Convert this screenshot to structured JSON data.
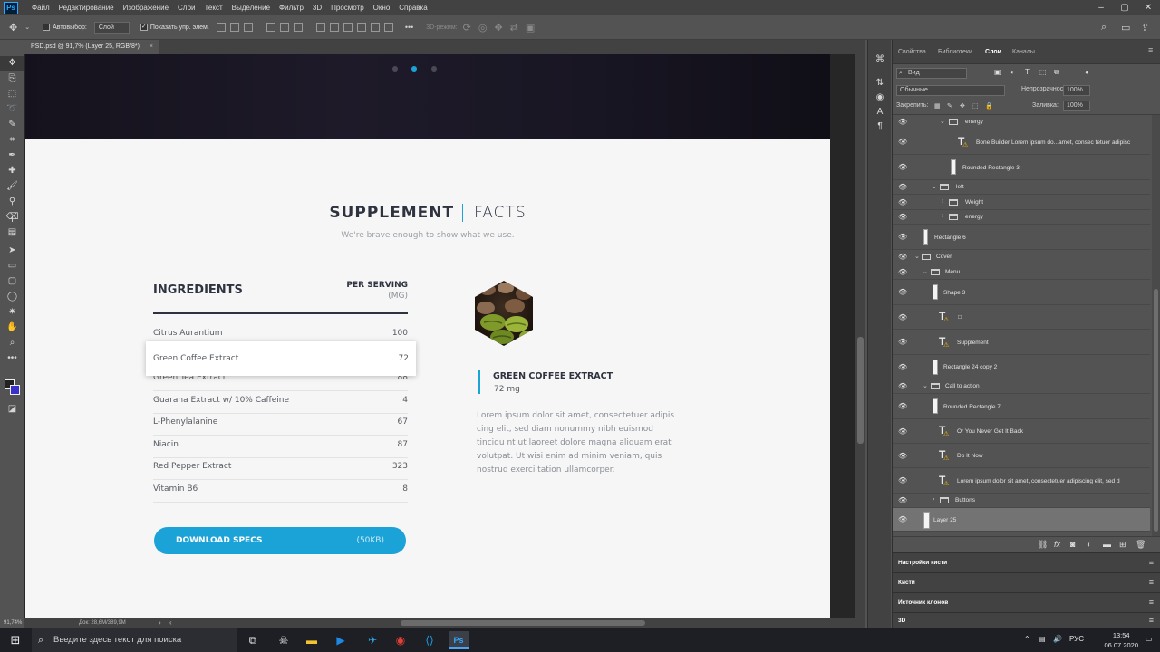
{
  "app": {
    "logo": "Ps",
    "menu": [
      "Файл",
      "Редактирование",
      "Изображение",
      "Слои",
      "Текст",
      "Выделение",
      "Фильтр",
      "3D",
      "Просмотр",
      "Окно",
      "Справка"
    ]
  },
  "options": {
    "autoselect_label": "Автовыбор:",
    "autoselect_value": "Слой",
    "show_transform": "Показать упр. элем.",
    "mode_3d": "3D-режим:",
    "more": "•••"
  },
  "document": {
    "tab_title": "PSD.psd @ 91,7% (Layer 25, RGB/8*)",
    "tab_close": "×",
    "zoom": "91,74%",
    "doc_size": "Док: 28,6M/389,9M"
  },
  "page": {
    "carousel_dots": 3,
    "carousel_active": 2,
    "section_title_bold": "SUPPLEMENT",
    "section_title_light": "FACTS",
    "section_subtitle": "We're brave enough to show what we use.",
    "ingredients_title": "INGREDIENTS",
    "per_serving": "PER SERVING",
    "per_serving_unit": "(MG)",
    "rows": [
      {
        "name": "Citrus Aurantium",
        "value": "100"
      },
      {
        "name": "Green Coffee Extract",
        "value": "72"
      },
      {
        "name": "Green Tea Extract",
        "value": "88"
      },
      {
        "name": "Guarana Extract w/ 10% Caffeine",
        "value": "4"
      },
      {
        "name": "L-Phenylalanine",
        "value": "67"
      },
      {
        "name": "Niacin",
        "value": "87"
      },
      {
        "name": "Red Pepper Extract",
        "value": "323"
      },
      {
        "name": "Vitamin B6",
        "value": "8"
      }
    ],
    "download_label": "DOWNLOAD SPECS",
    "download_size": "(50KB)",
    "product_name": "GREEN COFFEE EXTRACT",
    "product_amount": "72 mg",
    "product_desc": "Lorem ipsum dolor sit amet, consectetuer adipis cing elit, sed diam nonummy nibh euismod tincidu nt ut laoreet dolore magna aliquam erat volutpat. Ut wisi enim ad minim veniam, quis nostrud exerci tation ullamcorper.",
    "accent": "#1ba3d8",
    "dark": "#2f3340"
  },
  "panel": {
    "tabs": [
      "Свойства",
      "Библиотеки",
      "Слои",
      "Каналы"
    ],
    "filter_label": "Вид",
    "blend_mode": "Обычные",
    "opacity_label": "Непрозрачность:",
    "opacity": "100%",
    "lock_label": "Закрепить:",
    "fill_label": "Заливка:",
    "fill": "100%",
    "layers": [
      {
        "name": "energy",
        "type": "folder",
        "indent": 3,
        "open": true,
        "visible": true
      },
      {
        "name": "Bone Builder  Lorem ipsum do...amet, consec tetuer adipisc",
        "type": "text",
        "indent": 4,
        "visible": true
      },
      {
        "name": "Rounded Rectangle 3",
        "type": "shape",
        "indent": 3,
        "visible": true
      },
      {
        "name": "left",
        "type": "folder",
        "indent": 2,
        "open": true,
        "visible": true
      },
      {
        "name": "Weight",
        "type": "folder",
        "indent": 3,
        "open": false,
        "visible": true
      },
      {
        "name": "energy",
        "type": "folder",
        "indent": 3,
        "open": false,
        "visible": true
      },
      {
        "name": "Rectangle 6",
        "type": "shape",
        "indent": 1,
        "visible": true
      },
      {
        "name": "Cover",
        "type": "folder",
        "indent": 0,
        "open": true,
        "visible": true
      },
      {
        "name": "Menu",
        "type": "folder",
        "indent": 1,
        "open": true,
        "visible": true
      },
      {
        "name": "Shape 3",
        "type": "shape",
        "indent": 1,
        "visible": true
      },
      {
        "name": "□",
        "type": "text",
        "indent": 1,
        "visible": true
      },
      {
        "name": "Supplement",
        "type": "text",
        "indent": 1,
        "visible": true
      },
      {
        "name": "Rectangle 24 copy 2",
        "type": "shape",
        "indent": 1,
        "visible": true
      },
      {
        "name": "Call to action",
        "type": "folder",
        "indent": 1,
        "open": true,
        "visible": true
      },
      {
        "name": "Rounded Rectangle 7",
        "type": "shape",
        "indent": 1,
        "visible": true
      },
      {
        "name": "Or You Never Get It Back",
        "type": "text",
        "indent": 1,
        "visible": true
      },
      {
        "name": "Do It Now",
        "type": "text",
        "indent": 1,
        "visible": true
      },
      {
        "name": "Lorem ipsum dolor sit amet, consectetuer adipiscing elit, sed d",
        "type": "text",
        "indent": 1,
        "visible": true
      },
      {
        "name": "Buttons",
        "type": "folder",
        "indent": 1,
        "open": false,
        "visible": true
      },
      {
        "name": "Layer 25",
        "type": "shape",
        "indent": 0,
        "visible": true,
        "selected": true
      }
    ],
    "collapsed": [
      "Настройки кисти",
      "Кисти",
      "Источник клонов",
      "3D"
    ]
  },
  "taskbar": {
    "search_placeholder": "Введите здесь текст для поиска",
    "lang": "РУС",
    "time": "13:54",
    "date": "06.07.2020"
  }
}
